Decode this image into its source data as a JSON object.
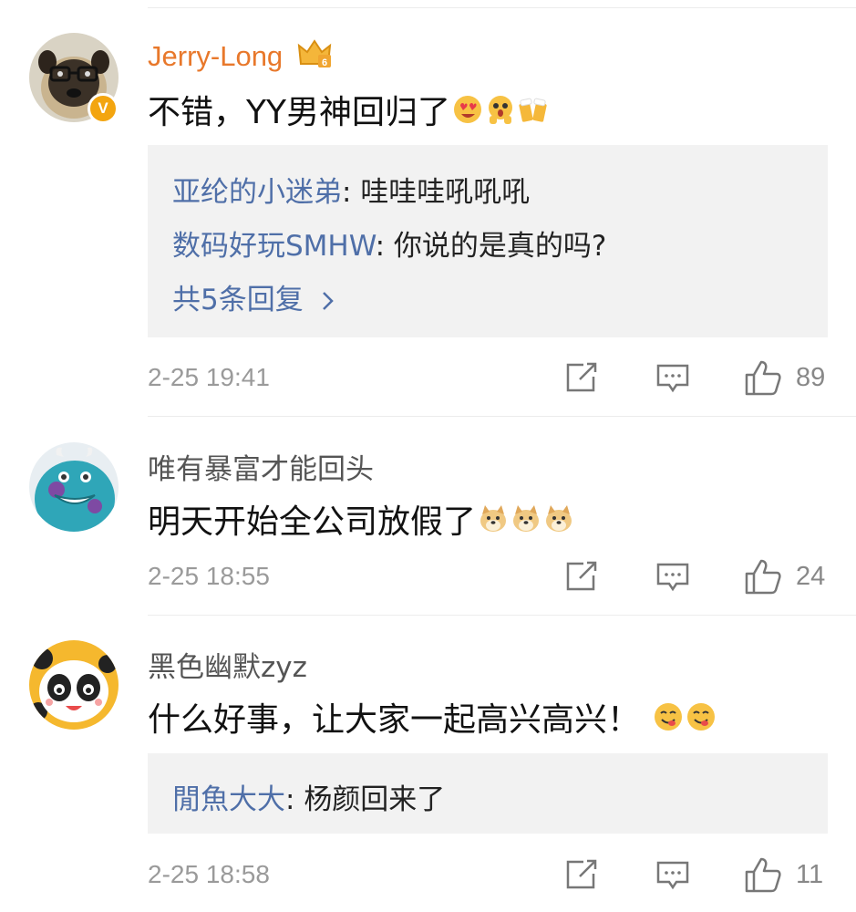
{
  "comments": [
    {
      "username": "Jerry-Long",
      "vip": true,
      "verified_badge": "V",
      "text": "不错，YY男神回归了",
      "emojis": [
        "heart-eyes-emoji",
        "shock-emoji",
        "cheers-emoji"
      ],
      "replies": [
        {
          "user": "亚纶的小迷弟",
          "sep": ": ",
          "text": "哇哇哇吼吼吼"
        },
        {
          "user": "数码好玩SMHW",
          "sep": ": ",
          "text": "你说的是真的吗?"
        }
      ],
      "more_replies": "共5条回复",
      "time": "2-25 19:41",
      "likes": "89"
    },
    {
      "username": "唯有暴富才能回头",
      "text": "明天开始全公司放假了",
      "emojis": [
        "doge-emoji",
        "doge-emoji",
        "doge-emoji"
      ],
      "time": "2-25 18:55",
      "likes": "24"
    },
    {
      "username": "黑色幽默zyz",
      "text": "什么好事，让大家一起高兴高兴！",
      "emojis": [
        "yummy-emoji",
        "yummy-emoji"
      ],
      "replies": [
        {
          "user": "閒魚大大",
          "sep": ": ",
          "text": "杨颜回来了"
        }
      ],
      "time": "2-25 18:58",
      "likes": "11"
    }
  ],
  "icons": {
    "share": "share-icon",
    "comment": "comment-icon",
    "like": "thumbs-up-icon",
    "vip_crown": "crown-badge-icon"
  },
  "colors": {
    "vip_name": "#e8782b",
    "reply_user": "#4f6fa8",
    "reply_bg": "#f2f2f2",
    "meta": "#9a9a9a"
  }
}
